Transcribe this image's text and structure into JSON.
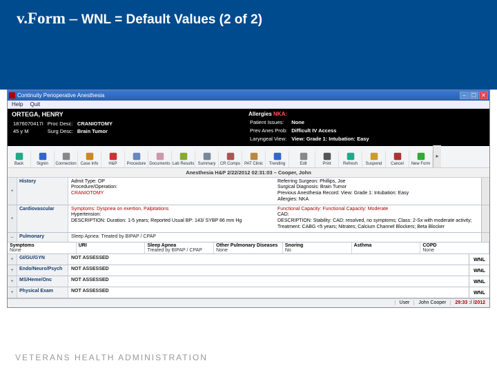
{
  "slide": {
    "title_prefix": "v.Form – ",
    "title_main": "WNL = Default Values (2 of 2)",
    "footer": "VETERANS HEALTH ADMINISTRATION"
  },
  "window": {
    "title": "Continuity Perioperative Anesthesia"
  },
  "menu": {
    "items": [
      "Help",
      "Quit"
    ]
  },
  "patient": {
    "name": "ORTEGA, HENRY",
    "ssn": "1876070417I",
    "age_sex": "45 y M",
    "proc_label": "Proc Desc:",
    "proc_val": "CRANIOTOMY",
    "surg_label": "Surg Desc:",
    "surg_val": "Brain Tumor",
    "allergies_label": "Allergies",
    "allergies_val": "NKA:",
    "issues_label": "Patient Issues:",
    "issues_val": "None",
    "prev_label": "Prev Anes Prob:",
    "prev_val": "Difficult IV Access",
    "lary_label": "Laryngeal View:",
    "lary_val": "View: Grade 1: Intubation: Easy"
  },
  "toolbar": {
    "items": [
      "Back",
      "Signin",
      "Connection",
      "Case Info",
      "H&P",
      "Procedure",
      "Documents",
      "Lab Results",
      "Summary",
      "CR Comps",
      "PAT Clinic",
      "Trending",
      "Edit",
      "Print",
      "Refresh",
      "Suspend",
      "Cancel",
      "New Form"
    ]
  },
  "hx": {
    "title": "Anesthesia H&P  2/22/2012 02:31:03 – Cooper, John",
    "history": {
      "label": "History",
      "left": {
        "l1": "Admit Type: OP",
        "l2": "Procedure/Operation:",
        "l3": "CRANIOTOMY"
      },
      "right": {
        "l1": "Referring Surgeon: Phillips, Joe",
        "l2": "Surgical Diagnosis: Brain Tumor",
        "l3": "Previous Anesthesia Record: View: Grade 1: Intubation: Easy",
        "l4": "Allergies: NKA"
      }
    },
    "cardio": {
      "label": "Cardiovascular",
      "left": {
        "l1": "Symptoms: Dyspnea on exertion, Palpitations",
        "l2": "Hypertension:",
        "l3": "DESCRIPTION: Duration: 1-5 years;  Reported Usual BP: 143/ SYBP 86 mm Hg"
      },
      "right": {
        "l1": "Functional Capacity: Functional Capacity: Moderate",
        "l2": "CAD:",
        "l3": "DESCRIPTION: Stability: CAD: resolved, no symptoms;  Class: 2-Sx with moderate activity;  Treatment: CABG <5 years; Nitrates; Calcium Channel Blockers; Beta Blocker"
      }
    },
    "pulmonary": {
      "label": "Pulmonary",
      "left": {
        "l1": "Sleep Apnea: Treated by BIPAP / CPAP"
      }
    },
    "symptoms": {
      "cols": [
        {
          "hd": "Symptoms",
          "vl": "None"
        },
        {
          "hd": "URI",
          "vl": ""
        },
        {
          "hd": "Sleep Apnea",
          "vl": "Treated by BIPAP / CPAP"
        },
        {
          "hd": "Other Pulmonary Diseases",
          "vl": "None"
        },
        {
          "hd": "Snoring",
          "vl": "No"
        },
        {
          "hd": "Asthma",
          "vl": ""
        },
        {
          "hd": "COPD",
          "vl": "None"
        }
      ]
    },
    "rows": [
      {
        "label": "GI/GU/GYN",
        "status": "NOT ASSESSED",
        "wnl": "WNL"
      },
      {
        "label": "Endo/Neuro/Psych",
        "status": "NOT ASSESSED",
        "wnl": "WNL"
      },
      {
        "label": "MS/Heme/Onc",
        "status": "NOT ASSESSED",
        "wnl": "WNL"
      },
      {
        "label": "Physical Exam",
        "status": "NOT ASSESSED",
        "wnl": "WNL"
      }
    ]
  },
  "status": {
    "user_label": "User",
    "user": "John Cooper",
    "date": "29:33 :/ /2012"
  }
}
